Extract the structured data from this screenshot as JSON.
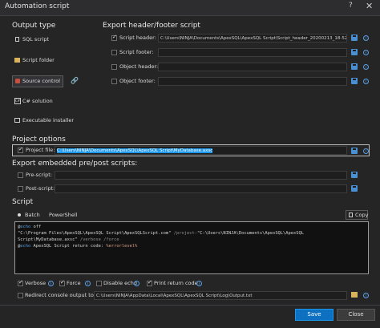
{
  "window": {
    "title": "Automation script",
    "help": "?",
    "close": "✕"
  },
  "output_type": {
    "heading": "Output type",
    "items": [
      {
        "label": "SQL script",
        "selected": false
      },
      {
        "label": "Script folder",
        "selected": false
      },
      {
        "label": "Source control",
        "selected": true
      },
      {
        "label": "C# solution",
        "selected": false
      },
      {
        "label": "Executable installer",
        "selected": false
      }
    ]
  },
  "export_header_footer": {
    "heading": "Export header/footer script",
    "rows": [
      {
        "label": "Script header:",
        "checked": true,
        "value": "C:\\Users\\NINJA\\Documents\\ApexSQL\\ApexSQL Script\\Script_header_20200213_18-52-"
      },
      {
        "label": "Script footer:",
        "checked": false,
        "value": ""
      },
      {
        "label": "Object header:",
        "checked": false,
        "value": ""
      },
      {
        "label": "Object footer:",
        "checked": false,
        "value": ""
      }
    ]
  },
  "project_options": {
    "heading": "Project options",
    "label": "Project file:",
    "checked": true,
    "value": "C:\\Users\\NINJA\\Documents\\ApexSQL\\ApexSQL Script\\MyDatabase.axsc"
  },
  "embedded": {
    "heading": "Export embedded pre/post scripts:",
    "rows": [
      {
        "label": "Pre-script:",
        "value": ""
      },
      {
        "label": "Post-script:",
        "value": ""
      }
    ]
  },
  "script": {
    "heading": "Script",
    "modes": [
      {
        "label": "Batch",
        "selected": true
      },
      {
        "label": "PowerShell",
        "selected": false
      }
    ],
    "copy_label": "Copy",
    "lines": {
      "l1_at": "@",
      "l1_echo": "echo",
      "l1_rest": " off",
      "l2_a": "\"C:\\Program Files\\ApexSQL\\ApexSQL Script\\ApexSQLScript.com\"",
      "l2_b": " /project:",
      "l2_c": "\"C:\\Users\\NINJA\\Documents\\ApexSQL\\ApexSQL",
      "l3_a": "Script\\MyDatabase.axsc\"",
      "l3_b": " /verbose /force",
      "l4_at": "@",
      "l4_echo": "echo",
      "l4_rest": " ApexSQL Script return code: ",
      "l4_var": "%errorlevel%"
    }
  },
  "flags": [
    {
      "label": "Verbose",
      "checked": true
    },
    {
      "label": "Force",
      "checked": true
    },
    {
      "label": "Disable echo",
      "checked": false
    },
    {
      "label": "Print return code",
      "checked": true
    }
  ],
  "redirect": {
    "label": "Redirect console output to file:",
    "checked": false,
    "value": "C:\\Users\\NINJA\\AppData\\Local\\ApexSQL\\ApexSQL Script\\Log\\Output.txt"
  },
  "footer": {
    "save_label": "Save",
    "cancel_label": "Close"
  },
  "colors": {
    "accent": "#0e70c0",
    "selection": "#1c97ea",
    "background": "#252526"
  }
}
